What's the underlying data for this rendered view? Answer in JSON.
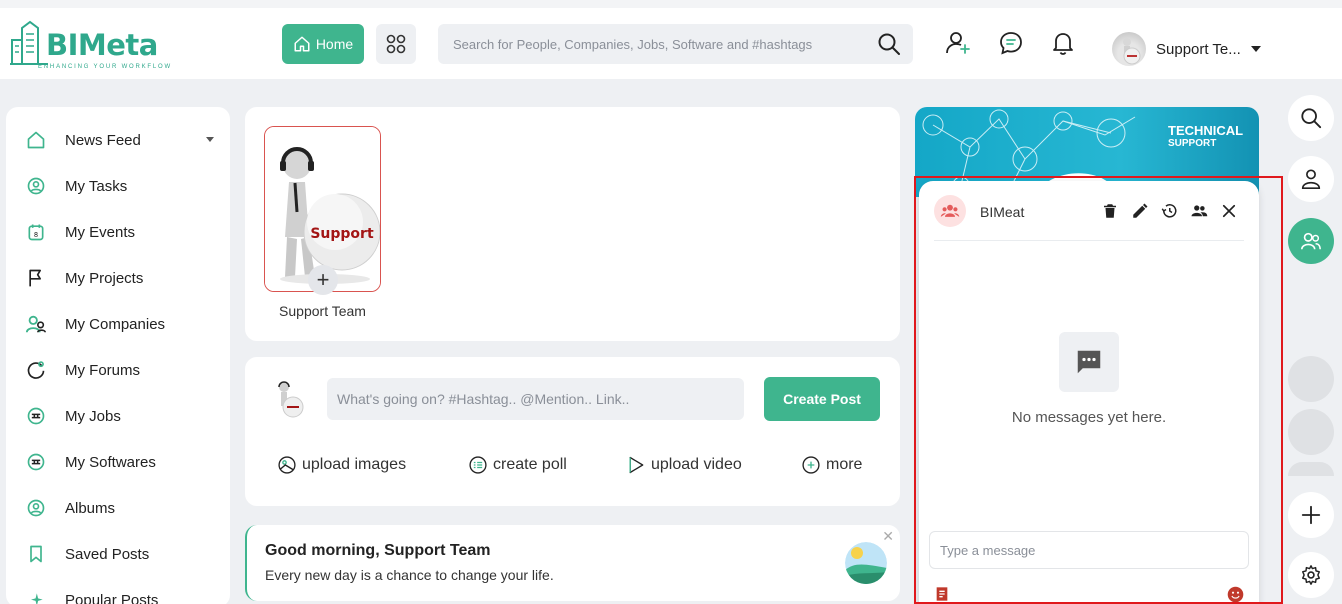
{
  "brand": {
    "name": "BIMeta",
    "tagline": "ENHANCING YOUR WORKFLOW",
    "accent": "#3fb58e"
  },
  "header": {
    "home_label": "Home",
    "search_placeholder": "Search for People, Companies, Jobs, Software and #hashtags",
    "user_name": "Support Te..."
  },
  "sidebar": {
    "items": [
      {
        "label": "News Feed",
        "icon": "home-icon"
      },
      {
        "label": "My Tasks",
        "icon": "tasks-icon"
      },
      {
        "label": "My Events",
        "icon": "calendar-icon"
      },
      {
        "label": "My Projects",
        "icon": "flag-icon"
      },
      {
        "label": "My Companies",
        "icon": "people-icon"
      },
      {
        "label": "My Forums",
        "icon": "forum-icon"
      },
      {
        "label": "My Jobs",
        "icon": "jobs-icon"
      },
      {
        "label": "My Softwares",
        "icon": "software-icon"
      },
      {
        "label": "Albums",
        "icon": "album-icon"
      },
      {
        "label": "Saved Posts",
        "icon": "bookmark-icon"
      },
      {
        "label": "Popular Posts",
        "icon": "sparkle-icon"
      }
    ]
  },
  "story": {
    "name": "Support Team",
    "image_text": "Support"
  },
  "composer": {
    "placeholder": "What's going on? #Hashtag.. @Mention.. Link..",
    "button_label": "Create Post",
    "actions": [
      "upload images",
      "create poll",
      "upload video",
      "more"
    ]
  },
  "greeting": {
    "title": "Good morning, Support Team",
    "subtitle": "Every new day is a chance to change your life."
  },
  "banner": {
    "title": "TECHNICAL",
    "subtitle": "SUPPORT"
  },
  "chat": {
    "name": "BIMeat",
    "empty_text": "No messages yet here.",
    "input_placeholder": "Type a message"
  }
}
